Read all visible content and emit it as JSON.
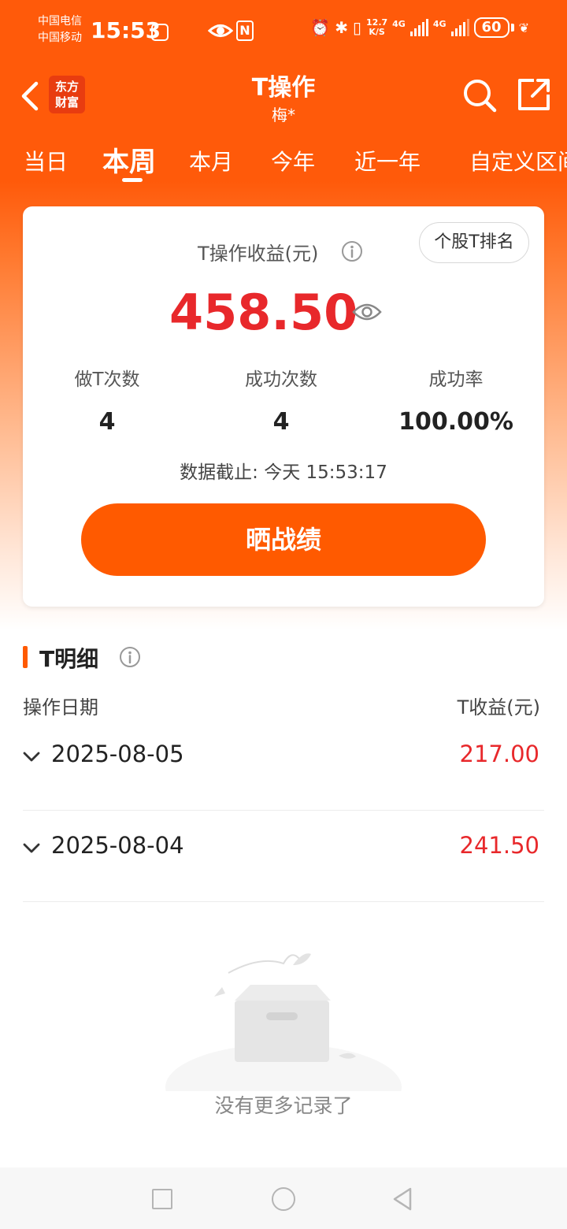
{
  "status_bar": {
    "carrier1": "中国电信",
    "carrier2": "中国移动",
    "time": "15:53",
    "net_speed_value": "12.7",
    "net_speed_unit": "K/S",
    "net_type1": "4G",
    "net_type2": "4G",
    "battery": "60"
  },
  "header": {
    "logo_line1": "东方",
    "logo_line2": "财富",
    "title": "T操作",
    "subtitle": "梅*"
  },
  "tabs": [
    {
      "label": "当日",
      "active": false
    },
    {
      "label": "本周",
      "active": true
    },
    {
      "label": "本月",
      "active": false
    },
    {
      "label": "今年",
      "active": false
    },
    {
      "label": "近一年",
      "active": false
    },
    {
      "label": "自定义区间",
      "active": false
    }
  ],
  "summary": {
    "profit_label": "T操作收益(元)",
    "rank_button": "个股T排名",
    "profit_value": "458.50",
    "stats": [
      {
        "label": "做T次数",
        "value": "4"
      },
      {
        "label": "成功次数",
        "value": "4"
      },
      {
        "label": "成功率",
        "value": "100.00%"
      }
    ],
    "data_time": "数据截止: 今天 15:53:17",
    "share_button": "晒战绩"
  },
  "detail": {
    "title": "T明细",
    "col_date": "操作日期",
    "col_profit": "T收益(元)",
    "rows": [
      {
        "date": "2025-08-05",
        "profit": "217.00"
      },
      {
        "date": "2025-08-04",
        "profit": "241.50"
      }
    ],
    "empty_text": "没有更多记录了"
  },
  "colors": {
    "brand_orange": "#ff5a00",
    "profit_red": "#e8282b"
  },
  "icons": [
    "back-icon",
    "search-icon",
    "share-icon",
    "info-icon",
    "eye-icon",
    "chevron-down-icon"
  ]
}
